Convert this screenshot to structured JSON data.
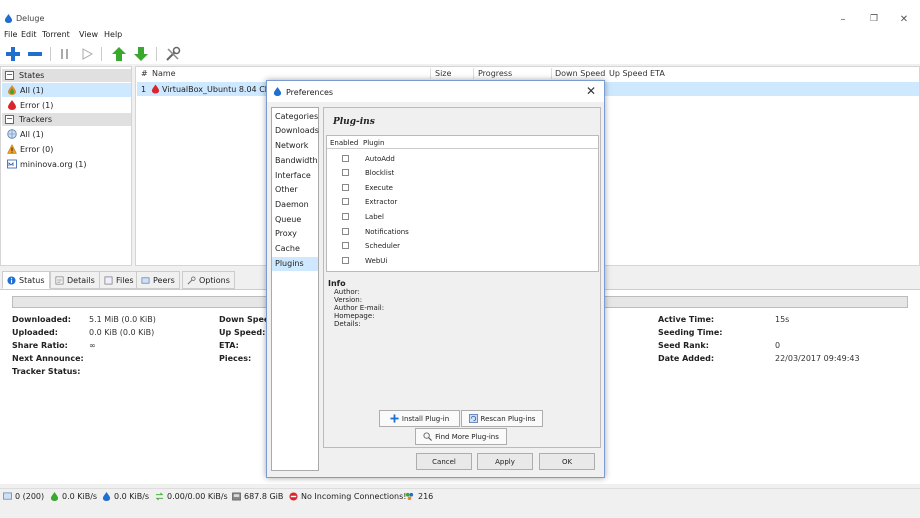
{
  "window": {
    "title": "Deluge"
  },
  "menu": [
    "File",
    "Edit",
    "Torrent",
    "View",
    "Help"
  ],
  "sidebar": {
    "states_header": "States",
    "states": [
      {
        "label": "All (1)",
        "icon": "all-icon"
      },
      {
        "label": "Error (1)",
        "icon": "error-icon"
      }
    ],
    "trackers_header": "Trackers",
    "trackers": [
      {
        "label": "All (1)",
        "icon": "globe-icon"
      },
      {
        "label": "Error (0)",
        "icon": "warning-icon"
      },
      {
        "label": "mininova.org (1)",
        "icon": "tracker-icon"
      }
    ]
  },
  "torrent_list": {
    "columns": [
      "#",
      "Name",
      "Size",
      "Progress",
      "Down Speed",
      "Up Speed",
      "ETA"
    ],
    "rows": [
      {
        "index": "1",
        "name": "VirtualBox_Ubuntu 8.04 Chr"
      }
    ]
  },
  "detail_tabs": [
    "Status",
    "Details",
    "Files",
    "Peers",
    "Options"
  ],
  "status": {
    "left": [
      {
        "label": "Downloaded:",
        "value": "5.1 MiB (0.0 KiB)"
      },
      {
        "label": "Uploaded:",
        "value": "0.0 KiB (0.0 KiB)"
      },
      {
        "label": "Share Ratio:",
        "value": "∞"
      },
      {
        "label": "Next Announce:",
        "value": ""
      },
      {
        "label": "Tracker Status:",
        "value": ""
      }
    ],
    "middle": [
      "Down Spee",
      "Up Speed:",
      "ETA:",
      "Pieces:"
    ],
    "right": [
      {
        "label": "Active Time:",
        "value": "15s"
      },
      {
        "label": "Seeding Time:",
        "value": ""
      },
      {
        "label": "Seed Rank:",
        "value": "0"
      },
      {
        "label": "Date Added:",
        "value": "22/03/2017 09:49:43"
      }
    ]
  },
  "statusbar": {
    "connections": "0 (200)",
    "download": "0.0 KiB/s",
    "upload": "0.0 KiB/s",
    "protocol": "0.00/0.00 KiB/s",
    "disk": "687.8 GiB",
    "incoming": "No Incoming Connections!",
    "dht": "216"
  },
  "preferences": {
    "title": "Preferences",
    "categories": [
      "Categories",
      "Downloads",
      "Network",
      "Bandwidth",
      "Interface",
      "Other",
      "Daemon",
      "Queue",
      "Proxy",
      "Cache",
      "Plugins"
    ],
    "selected_category": "Plugins",
    "pane_title": "Plug-ins",
    "plugin_columns": [
      "Enabled",
      "Plugin"
    ],
    "plugins": [
      {
        "name": "AutoAdd",
        "enabled": false
      },
      {
        "name": "Blocklist",
        "enabled": false
      },
      {
        "name": "Execute",
        "enabled": false
      },
      {
        "name": "Extractor",
        "enabled": false
      },
      {
        "name": "Label",
        "enabled": false
      },
      {
        "name": "Notifications",
        "enabled": false
      },
      {
        "name": "Scheduler",
        "enabled": false
      },
      {
        "name": "WebUi",
        "enabled": false
      }
    ],
    "info_header": "Info",
    "info_fields": [
      "Author:",
      "Version:",
      "Author E-mail:",
      "Homepage:",
      "Details:"
    ],
    "install_label": "Install Plug-in",
    "rescan_label": "Rescan Plug-ins",
    "find_more_label": "Find More Plug-ins",
    "cancel_label": "Cancel",
    "apply_label": "Apply",
    "ok_label": "OK"
  },
  "colors": {
    "selection": "#cde8ff",
    "accent_blue": "#1f6fd1",
    "green_arrow": "#3aa82e",
    "error_red": "#d9262c"
  }
}
